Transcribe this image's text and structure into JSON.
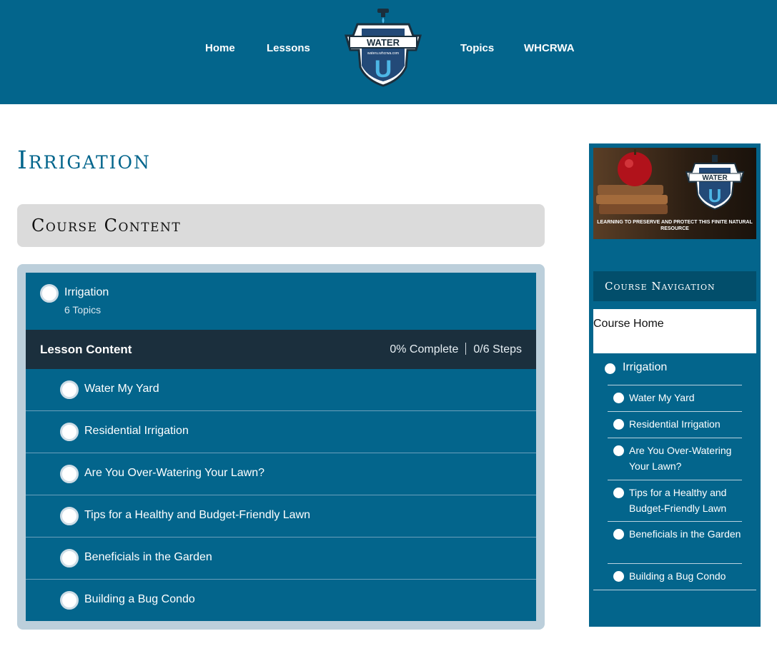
{
  "header": {
    "nav": [
      "Home",
      "Lessons",
      "Topics",
      "WHCRWA"
    ],
    "logo_text": "WATER",
    "logo_url_text": "wateru.whcrwa.com",
    "logo_letter": "U"
  },
  "page": {
    "title": "Irrigation",
    "course_content_title": "Course Content"
  },
  "lesson": {
    "title": "Irrigation",
    "subtitle": "6 Topics",
    "content_label": "Lesson Content",
    "progress": "0% Complete",
    "steps": "0/6 Steps",
    "topics": [
      "Water My Yard",
      "Residential Irrigation",
      "Are You Over-Watering Your Lawn?",
      "Tips for a Healthy and Budget-Friendly Lawn",
      "Beneficials in the Garden",
      "Building a Bug Condo"
    ]
  },
  "sidebar": {
    "banner_text": "LEARNING TO PRESERVE AND PROTECT THIS FINITE NATURAL RESOURCE",
    "banner_logo_text": "WATER",
    "banner_logo_letter": "U",
    "nav_title": "Course Navigation",
    "home_link": "Course Home",
    "lesson": "Irrigation",
    "topics": [
      "Water My Yard",
      "Residential Irrigation",
      "Are You Over-Watering Your Lawn?",
      "Tips for a Healthy and Budget-Friendly Lawn",
      "Beneficials in the Garden",
      "Building a Bug Condo"
    ]
  },
  "colors": {
    "brand_blue": "#03658c",
    "dark_bar": "#1b2f3d",
    "light_gray": "#dbdbdb",
    "frame": "#bccfdb"
  }
}
